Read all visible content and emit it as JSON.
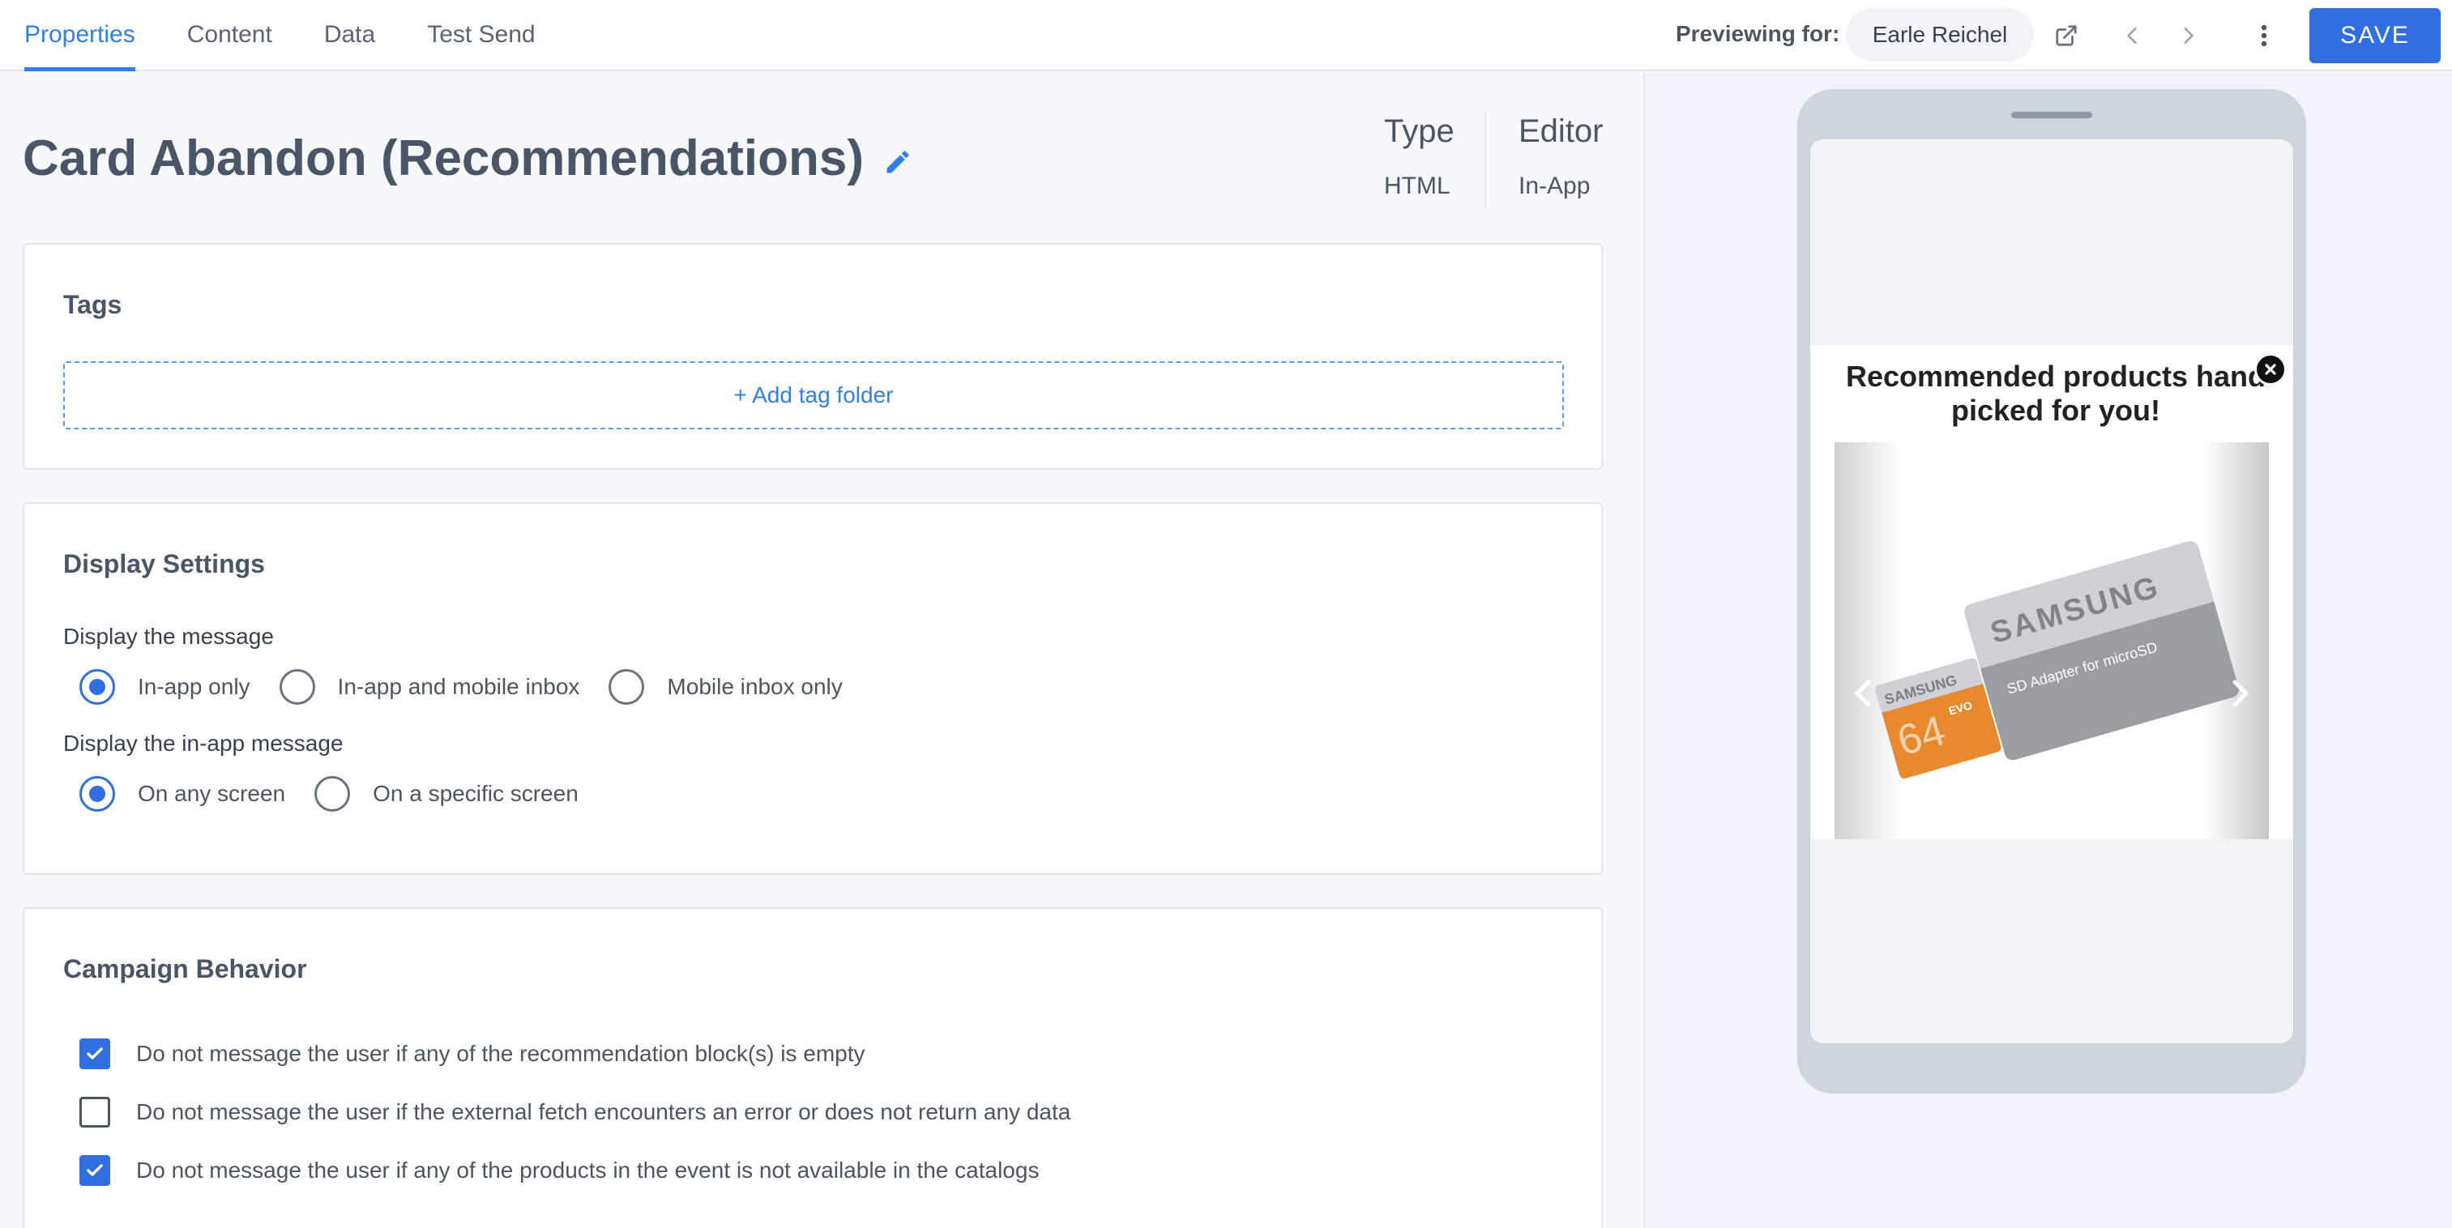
{
  "tabs": [
    {
      "label": "Properties",
      "active": true
    },
    {
      "label": "Content",
      "active": false
    },
    {
      "label": "Data",
      "active": false
    },
    {
      "label": "Test Send",
      "active": false
    }
  ],
  "header": {
    "previewing_label": "Previewing for:",
    "preview_user": "Earle Reichel",
    "save_label": "SAVE",
    "icons": [
      "external-link-icon",
      "chevron-left-icon",
      "chevron-right-icon",
      "more-vertical-icon"
    ]
  },
  "page": {
    "title": "Card Abandon (Recommendations)",
    "type_label": "Type",
    "type_value": "HTML",
    "editor_label": "Editor",
    "editor_value": "In-App"
  },
  "tags": {
    "title": "Tags",
    "add_label": "+ Add tag folder"
  },
  "display": {
    "title": "Display Settings",
    "message_label": "Display the message",
    "message_options": [
      "In-app only",
      "In-app and mobile inbox",
      "Mobile inbox only"
    ],
    "message_selected": "In-app only",
    "inapp_label": "Display the in-app message",
    "inapp_options": [
      "On any screen",
      "On a specific screen"
    ],
    "inapp_selected": "On any screen"
  },
  "behavior": {
    "title": "Campaign Behavior",
    "items": [
      {
        "label": "Do not message the user if any of the recommendation block(s) is empty",
        "checked": true
      },
      {
        "label": "Do not message the user if the external fetch encounters an error or does not return any data",
        "checked": false
      },
      {
        "label": "Do not message the user if any of the products in the event is not available in the catalogs",
        "checked": true
      }
    ]
  },
  "preview": {
    "headline": "Recommended products hand picked for you!",
    "product_brand": "SAMSUNG",
    "product_caption": "SD Adapter for microSD",
    "card_brand": "SAMSUNG",
    "card_capacity": "64",
    "card_series": "EVO"
  },
  "colors": {
    "accent": "#2f80ed",
    "primary_button": "#2f6fe0",
    "card_orange": "#e8892e"
  }
}
